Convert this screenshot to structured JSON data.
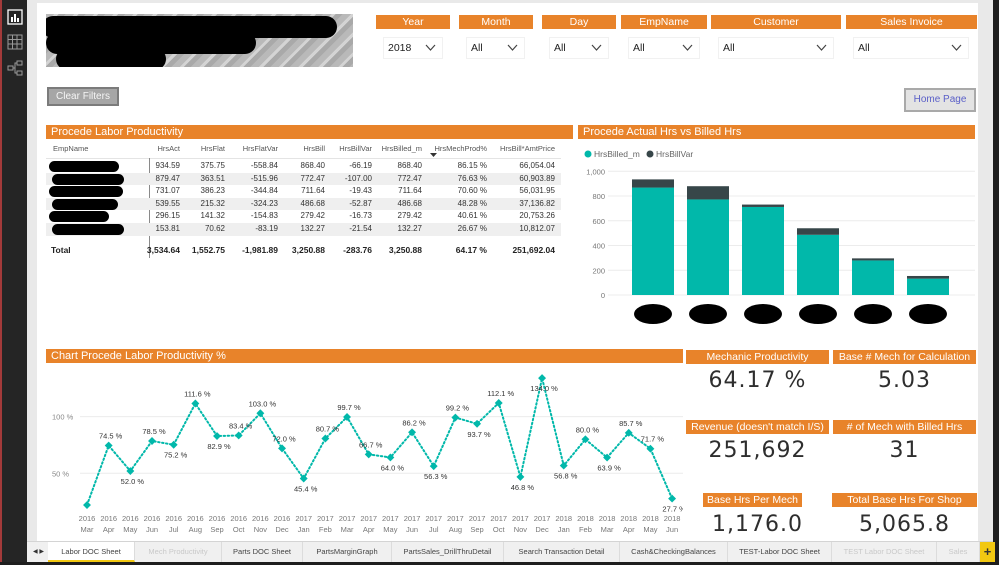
{
  "sidebar": {
    "icons": [
      "report-view-icon",
      "data-view-icon",
      "model-view-icon"
    ]
  },
  "buttons": {
    "clear_filters": "Clear Filters",
    "home_page": "Home Page"
  },
  "slicers": [
    {
      "title": "Year",
      "value": "2018"
    },
    {
      "title": "Month",
      "value": "All"
    },
    {
      "title": "Day",
      "value": "All"
    },
    {
      "title": "EmpName",
      "value": "All"
    },
    {
      "title": "Customer",
      "value": "All"
    },
    {
      "title": "Sales Invoice",
      "value": "All"
    }
  ],
  "table": {
    "title": "Procede Labor Productivity",
    "columns": [
      "EmpName",
      "HrsAct",
      "HrsFlat",
      "HrsFlatVar",
      "HrsBill",
      "HrsBillVar",
      "HrsBilled_m",
      "HrsMechProd%",
      "HrsBill*AmtPrice"
    ],
    "sorted_column": "HrsMechProd%",
    "rows": [
      [
        "",
        "934.59",
        "375.75",
        "-558.84",
        "868.40",
        "-66.19",
        "868.40",
        "86.15 %",
        "66,054.04"
      ],
      [
        "",
        "879.47",
        "363.51",
        "-515.96",
        "772.47",
        "-107.00",
        "772.47",
        "76.63 %",
        "60,903.89"
      ],
      [
        "",
        "731.07",
        "386.23",
        "-344.84",
        "711.64",
        "-19.43",
        "711.64",
        "70.60 %",
        "56,031.95"
      ],
      [
        "",
        "539.55",
        "215.32",
        "-324.23",
        "486.68",
        "-52.87",
        "486.68",
        "48.28 %",
        "37,136.82"
      ],
      [
        "",
        "296.15",
        "141.32",
        "-154.83",
        "279.42",
        "-16.73",
        "279.42",
        "40.61 %",
        "20,753.26"
      ],
      [
        "",
        "153.81",
        "70.62",
        "-83.19",
        "132.27",
        "-21.54",
        "132.27",
        "26.67 %",
        "10,812.07"
      ]
    ],
    "total": [
      "Total",
      "3,534.64",
      "1,552.75",
      "-1,981.89",
      "3,250.88",
      "-283.76",
      "3,250.88",
      "64.17 %",
      "251,692.04"
    ]
  },
  "kpis": [
    {
      "title": "Mechanic Productivity",
      "value": "64.17 %"
    },
    {
      "title": "Base # Mech for Calculation",
      "value": "5.03"
    },
    {
      "title": "Revenue (doesn't match I/S)",
      "value": "251,692"
    },
    {
      "title": "# of Mech with Billed Hrs",
      "value": "31"
    },
    {
      "title": "Base Hrs Per Mech",
      "value": "1,176.0"
    },
    {
      "title": "Total Base Hrs For Shop",
      "value": "5,065.8"
    }
  ],
  "tabs": {
    "nav": "◀ ▶",
    "items": [
      {
        "label": "Labor DOC Sheet",
        "state": "active"
      },
      {
        "label": "Mech Productivity",
        "state": "hidden"
      },
      {
        "label": "Parts DOC Sheet",
        "state": "normal"
      },
      {
        "label": "PartsMarginGraph",
        "state": "normal"
      },
      {
        "label": "PartsSales_DrillThruDetail",
        "state": "normal"
      },
      {
        "label": "Search Transaction Detail",
        "state": "normal"
      },
      {
        "label": "Cash&CheckingBalances",
        "state": "normal"
      },
      {
        "label": "TEST-Labor DOC Sheet",
        "state": "normal"
      },
      {
        "label": "TEST Labor DOC Sheet",
        "state": "hidden"
      },
      {
        "label": "Sales",
        "state": "hidden"
      }
    ],
    "add_label": "+"
  },
  "colors": {
    "accent": "#e8832a",
    "teal": "#01b8aa",
    "dark": "#374649",
    "add_tab": "#f2c811"
  },
  "chart_data": [
    {
      "type": "bar",
      "stacked": true,
      "title": "Procede Actual Hrs vs Billed Hrs",
      "categories": [
        "(redacted)",
        "(redacted)",
        "(redacted)",
        "(redacted)",
        "(redacted)",
        "(redacted)"
      ],
      "series": [
        {
          "name": "HrsBilled_m",
          "color": "#01b8aa",
          "values": [
            868.4,
            772.47,
            711.64,
            486.68,
            279.42,
            132.27
          ]
        },
        {
          "name": "HrsBillVar",
          "color": "#374649",
          "values": [
            66.19,
            107.0,
            19.43,
            52.87,
            16.73,
            21.54
          ]
        }
      ],
      "yticks": [
        0,
        200,
        400,
        600,
        800,
        1000
      ],
      "ytick_labels": [
        "0",
        "200",
        "400",
        "600",
        "800",
        "1,000"
      ],
      "ylim": [
        0,
        1000
      ],
      "xlabel": "",
      "ylabel": "",
      "legend": "top-left",
      "grid": true
    },
    {
      "type": "line",
      "title": "Chart Procede Labor Productivity %",
      "x_years": [
        "2016",
        "2016",
        "2016",
        "2016",
        "2016",
        "2016",
        "2016",
        "2016",
        "2016",
        "2016",
        "2017",
        "2017",
        "2017",
        "2017",
        "2017",
        "2017",
        "2017",
        "2017",
        "2017",
        "2017",
        "2017",
        "2017",
        "2018",
        "2018",
        "2018",
        "2018",
        "2018",
        "2018"
      ],
      "x_months": [
        "Mar",
        "Apr",
        "May",
        "Jun",
        "Jul",
        "Aug",
        "Sep",
        "Oct",
        "Nov",
        "Dec",
        "Jan",
        "Feb",
        "Mar",
        "Apr",
        "May",
        "Jun",
        "Jul",
        "Aug",
        "Sep",
        "Oct",
        "Nov",
        "Dec",
        "Jan",
        "Feb",
        "Mar",
        "Apr",
        "May",
        "Jun"
      ],
      "values": [
        22.0,
        74.5,
        52.0,
        78.5,
        75.2,
        111.6,
        82.9,
        83.4,
        103.0,
        72.0,
        45.4,
        80.7,
        99.7,
        66.7,
        64.0,
        86.2,
        56.3,
        99.2,
        93.7,
        112.1,
        46.8,
        134.0,
        56.8,
        80.0,
        63.9,
        85.7,
        71.7,
        27.7
      ],
      "labels": [
        "",
        "74.5 %",
        "52.0 %",
        "78.5 %",
        "75.2 %",
        "111.6 %",
        "82.9 %",
        "83.4 %",
        "103.0 %",
        "72.0 %",
        "45.4 %",
        "80.7 %",
        "99.7 %",
        "66.7 %",
        "64.0 %",
        "86.2 %",
        "56.3 %",
        "99.2 %",
        "93.7 %",
        "112.1 %",
        "46.8 %",
        "134.0 %",
        "56.8 %",
        "80.0 %",
        "63.9 %",
        "85.7 %",
        "71.7 %",
        "27.7 %"
      ],
      "yticks": [
        50,
        100
      ],
      "ytick_labels": [
        "50 %",
        "100 %"
      ],
      "ylim": [
        15,
        140
      ],
      "xlabel": "",
      "ylabel": "",
      "color": "#01b8aa",
      "line_style": "dotted",
      "grid": true
    }
  ]
}
